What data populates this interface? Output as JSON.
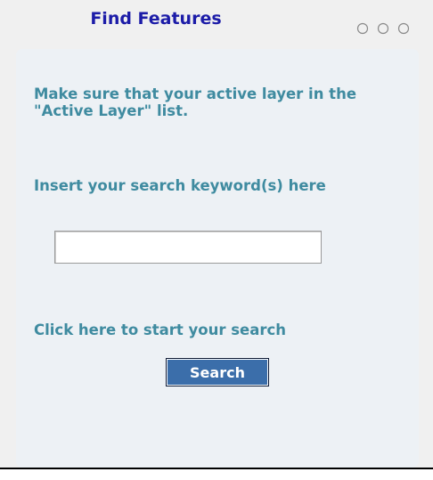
{
  "panel": {
    "title": "Find Features",
    "window_controls_icon": "three-circles-icon"
  },
  "instructions": {
    "active_layer_note": "Make sure that your active layer in the \"Active Layer\" list.",
    "keyword_prompt": "Insert your search keyword(s) here",
    "start_prompt": "Click here to start your search"
  },
  "search": {
    "value": "",
    "placeholder": "",
    "button_label": "Search"
  },
  "colors": {
    "title": "#1c1ca8",
    "label": "#3f8ba0",
    "button": "#3b6eaa",
    "panel_bg": "#edf1f5"
  }
}
